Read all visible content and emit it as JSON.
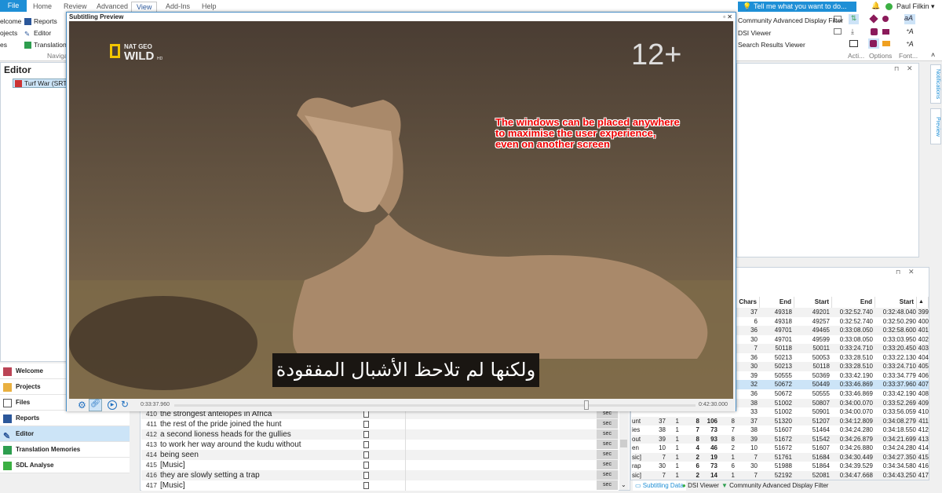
{
  "ribbon": {
    "file": "File",
    "tabs": [
      "Home",
      "Review",
      "Advanced",
      "View",
      "Add-Ins",
      "Help"
    ],
    "selected_tab": "View",
    "tell_me": "Tell me what you want to do...",
    "user": "Paul Filkin",
    "nav_items": [
      "elcome",
      "ojects",
      "es"
    ],
    "nav_items2": [
      "Reports",
      "Editor",
      "Translation M"
    ],
    "nav_group": "Navigat",
    "views": [
      "Community Advanced Display Filter",
      "DSI Viewer",
      "Search Results Viewer"
    ],
    "groups": [
      "Acti...",
      "Options",
      "Font..."
    ]
  },
  "left": {
    "title": "Editor",
    "file": "Turf War (SRT).sr",
    "nav": [
      "Welcome",
      "Projects",
      "Files",
      "Reports",
      "Editor",
      "Translation Memories",
      "SDL Analyse"
    ],
    "selected": "Editor"
  },
  "editor_rows": [
    {
      "n": "410",
      "t": "the strongest antelopes in Africa"
    },
    {
      "n": "411",
      "t": "the rest of the pride joined the hunt"
    },
    {
      "n": "412",
      "t": "a second lioness heads for the gullies"
    },
    {
      "n": "413",
      "t": "to work her way around the kudu without"
    },
    {
      "n": "414",
      "t": "being seen"
    },
    {
      "n": "415",
      "t": "[Music]"
    },
    {
      "n": "416",
      "t": "they are slowly setting a trap"
    },
    {
      "n": "417",
      "t": "[Music]"
    }
  ],
  "sec_label": "sec",
  "subtitling_table": {
    "headers": [
      "Chars",
      "End Frames",
      "Start Frames",
      "End",
      "Start"
    ],
    "rows": [
      {
        "chars": "37",
        "ef": "49318",
        "sf": "49201",
        "end": "0:32:52.740",
        "start": "0:32:48.040",
        "num": "399"
      },
      {
        "chars": "6",
        "ef": "49318",
        "sf": "49257",
        "end": "0:32:52.740",
        "start": "0:32:50.290",
        "num": "400"
      },
      {
        "chars": "36",
        "ef": "49701",
        "sf": "49465",
        "end": "0:33:08.050",
        "start": "0:32:58.600",
        "num": "401"
      },
      {
        "chars": "30",
        "ef": "49701",
        "sf": "49599",
        "end": "0:33:08.050",
        "start": "0:33:03.950",
        "num": "402"
      },
      {
        "chars": "7",
        "ef": "50118",
        "sf": "50011",
        "end": "0:33:24.710",
        "start": "0:33:20.450",
        "num": "403"
      },
      {
        "chars": "36",
        "ef": "50213",
        "sf": "50053",
        "end": "0:33:28.510",
        "start": "0:33:22.130",
        "num": "404"
      },
      {
        "chars": "30",
        "ef": "50213",
        "sf": "50118",
        "end": "0:33:28.510",
        "start": "0:33:24.710",
        "num": "405"
      },
      {
        "chars": "39",
        "ef": "50555",
        "sf": "50369",
        "end": "0:33:42.190",
        "start": "0:33:34.779",
        "num": "406"
      },
      {
        "chars": "32",
        "ef": "50672",
        "sf": "50449",
        "end": "0:33:46.869",
        "start": "0:33:37.960",
        "num": "407",
        "selected": true
      },
      {
        "chars": "36",
        "ef": "50672",
        "sf": "50555",
        "end": "0:33:46.869",
        "start": "0:33:42.190",
        "num": "408"
      },
      {
        "chars": "38",
        "ef": "51002",
        "sf": "50807",
        "end": "0:34:00.070",
        "start": "0:33:52.269",
        "num": "409"
      },
      {
        "chars": "33",
        "ef": "51002",
        "sf": "50901",
        "end": "0:34:00.070",
        "start": "0:33:56.059",
        "num": "410"
      },
      {
        "txt": "unt",
        "a": "37",
        "b": "1",
        "c": "8",
        "d": "106",
        "e": "8",
        "chars": "37",
        "ef": "51320",
        "sf": "51207",
        "end": "0:34:12.809",
        "start": "0:34:08.279",
        "num": "411"
      },
      {
        "txt": "ies",
        "a": "38",
        "b": "1",
        "c": "7",
        "d": "73",
        "e": "7",
        "chars": "38",
        "ef": "51607",
        "sf": "51464",
        "end": "0:34:24.280",
        "start": "0:34:18.550",
        "num": "412"
      },
      {
        "txt": "out",
        "a": "39",
        "b": "1",
        "c": "8",
        "d": "93",
        "e": "8",
        "chars": "39",
        "ef": "51672",
        "sf": "51542",
        "end": "0:34:26.879",
        "start": "0:34:21.699",
        "num": "413"
      },
      {
        "txt": "en",
        "a": "10",
        "b": "1",
        "c": "4",
        "d": "46",
        "e": "2",
        "chars": "10",
        "ef": "51672",
        "sf": "51607",
        "end": "0:34:26.880",
        "start": "0:34:24.280",
        "num": "414"
      },
      {
        "txt": "sic]",
        "a": "7",
        "b": "1",
        "c": "2",
        "d": "19",
        "e": "1",
        "chars": "7",
        "ef": "51761",
        "sf": "51684",
        "end": "0:34:30.449",
        "start": "0:34:27.350",
        "num": "415"
      },
      {
        "txt": "rap",
        "a": "30",
        "b": "1",
        "c": "6",
        "d": "73",
        "e": "6",
        "chars": "30",
        "ef": "51988",
        "sf": "51864",
        "end": "0:34:39.529",
        "start": "0:34:34.580",
        "num": "416"
      },
      {
        "txt": "sic]",
        "a": "7",
        "b": "1",
        "c": "2",
        "d": "14",
        "e": "1",
        "chars": "7",
        "ef": "52192",
        "sf": "52081",
        "end": "0:34:47.668",
        "start": "0:34:43.250",
        "num": "417"
      }
    ]
  },
  "bottom_tabs": [
    "Subtitling Data",
    "DSI Viewer",
    "Community Advanced Display Filter"
  ],
  "side_tabs": [
    "Notifications",
    "Preview"
  ],
  "preview": {
    "title": "Subtitling Preview",
    "logo_top": "NAT GEO",
    "logo_main": "WILD",
    "logo_hd": "HD",
    "rating": "12+",
    "note": [
      "The windows can be placed anywhere",
      "to maximise the user experience,",
      "even on another screen"
    ],
    "subtitle": "ولكنها لم تلاحظ الأشبال المفقودة",
    "current_time": "0:33:37.960",
    "total_time": "0:42:30.000",
    "progress": 0.79
  },
  "colors": {
    "accent": "#1e8fd6",
    "note": "#e00000",
    "selected_row": "#cce4f7"
  }
}
